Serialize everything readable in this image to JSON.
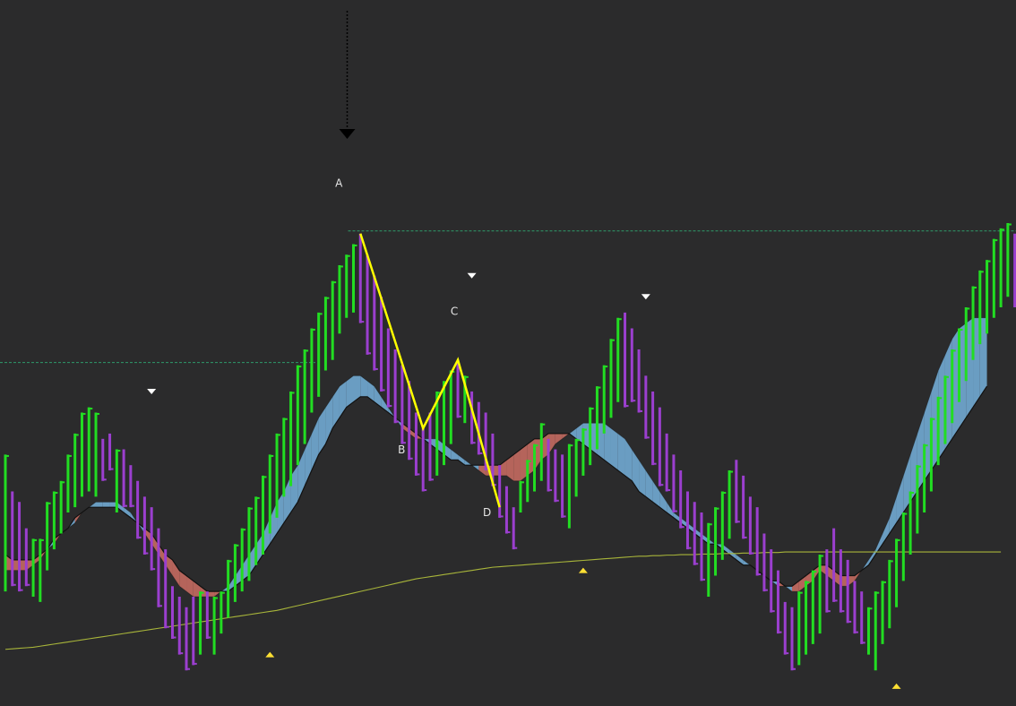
{
  "chart_data": {
    "type": "ohlc-bar",
    "background": "#2b2b2c",
    "colors": {
      "up_bar": "#22dd22",
      "down_bar": "#9b3fcf",
      "cloud_bull": "#6a9dc2",
      "cloud_bear": "#b5645b",
      "slow_ma": "#a8b53a",
      "abcd_pattern": "#ffff00",
      "signal_marker_down": "#ffffff",
      "signal_marker_up": "#ffe033",
      "level_line": "#2e9b6a"
    },
    "price_range": [
      0,
      100
    ],
    "bars": [
      {
        "h": 38,
        "l": 12,
        "d": "u"
      },
      {
        "h": 31,
        "l": 13,
        "d": "d"
      },
      {
        "h": 29,
        "l": 12,
        "d": "d"
      },
      {
        "h": 24,
        "l": 13,
        "d": "d"
      },
      {
        "h": 22,
        "l": 11,
        "d": "u"
      },
      {
        "h": 22,
        "l": 10,
        "d": "u"
      },
      {
        "h": 29,
        "l": 16,
        "d": "u"
      },
      {
        "h": 31,
        "l": 20,
        "d": "u"
      },
      {
        "h": 33,
        "l": 23,
        "d": "u"
      },
      {
        "h": 38,
        "l": 27,
        "d": "u"
      },
      {
        "h": 42,
        "l": 28,
        "d": "u"
      },
      {
        "h": 46,
        "l": 30,
        "d": "u"
      },
      {
        "h": 47,
        "l": 31,
        "d": "u"
      },
      {
        "h": 46,
        "l": 30,
        "d": "u"
      },
      {
        "h": 41,
        "l": 33,
        "d": "d"
      },
      {
        "h": 42,
        "l": 35,
        "d": "d"
      },
      {
        "h": 39,
        "l": 27,
        "d": "u"
      },
      {
        "h": 39,
        "l": 28,
        "d": "d"
      },
      {
        "h": 36,
        "l": 28,
        "d": "d"
      },
      {
        "h": 33,
        "l": 22,
        "d": "d"
      },
      {
        "h": 30,
        "l": 19,
        "d": "d"
      },
      {
        "h": 28,
        "l": 16,
        "d": "d"
      },
      {
        "h": 24,
        "l": 9,
        "d": "d"
      },
      {
        "h": 20,
        "l": 5,
        "d": "d"
      },
      {
        "h": 13,
        "l": 3,
        "d": "d"
      },
      {
        "h": 11,
        "l": 0,
        "d": "d"
      },
      {
        "h": 9,
        "l": -3,
        "d": "d"
      },
      {
        "h": 11,
        "l": -2,
        "d": "d"
      },
      {
        "h": 12,
        "l": 0,
        "d": "u"
      },
      {
        "h": 12,
        "l": 3,
        "d": "d"
      },
      {
        "h": 11,
        "l": 0,
        "d": "u"
      },
      {
        "h": 12,
        "l": 4,
        "d": "u"
      },
      {
        "h": 18,
        "l": 7,
        "d": "u"
      },
      {
        "h": 21,
        "l": 10,
        "d": "u"
      },
      {
        "h": 24,
        "l": 12,
        "d": "u"
      },
      {
        "h": 28,
        "l": 14,
        "d": "u"
      },
      {
        "h": 30,
        "l": 17,
        "d": "u"
      },
      {
        "h": 34,
        "l": 19,
        "d": "u"
      },
      {
        "h": 38,
        "l": 23,
        "d": "u"
      },
      {
        "h": 42,
        "l": 26,
        "d": "u"
      },
      {
        "h": 45,
        "l": 30,
        "d": "u"
      },
      {
        "h": 50,
        "l": 32,
        "d": "u"
      },
      {
        "h": 55,
        "l": 36,
        "d": "u"
      },
      {
        "h": 58,
        "l": 40,
        "d": "u"
      },
      {
        "h": 62,
        "l": 46,
        "d": "u"
      },
      {
        "h": 65,
        "l": 49,
        "d": "u"
      },
      {
        "h": 68,
        "l": 54,
        "d": "u"
      },
      {
        "h": 71,
        "l": 56,
        "d": "u"
      },
      {
        "h": 74,
        "l": 61,
        "d": "u"
      },
      {
        "h": 76,
        "l": 64,
        "d": "u"
      },
      {
        "h": 78,
        "l": 65,
        "d": "u"
      },
      {
        "h": 80,
        "l": 63,
        "d": "d"
      },
      {
        "h": 76,
        "l": 57,
        "d": "d"
      },
      {
        "h": 72,
        "l": 54,
        "d": "d"
      },
      {
        "h": 68,
        "l": 50,
        "d": "d"
      },
      {
        "h": 62,
        "l": 47,
        "d": "d"
      },
      {
        "h": 58,
        "l": 44,
        "d": "d"
      },
      {
        "h": 55,
        "l": 40,
        "d": "d"
      },
      {
        "h": 52,
        "l": 37,
        "d": "d"
      },
      {
        "h": 46,
        "l": 34,
        "d": "d"
      },
      {
        "h": 43,
        "l": 31,
        "d": "d"
      },
      {
        "h": 46,
        "l": 33,
        "d": "d"
      },
      {
        "h": 50,
        "l": 34,
        "d": "u"
      },
      {
        "h": 52,
        "l": 36,
        "d": "u"
      },
      {
        "h": 54,
        "l": 40,
        "d": "u"
      },
      {
        "h": 56,
        "l": 45,
        "d": "d"
      },
      {
        "h": 53,
        "l": 44,
        "d": "u"
      },
      {
        "h": 50,
        "l": 40,
        "d": "d"
      },
      {
        "h": 48,
        "l": 38,
        "d": "d"
      },
      {
        "h": 46,
        "l": 35,
        "d": "d"
      },
      {
        "h": 42,
        "l": 32,
        "d": "d"
      },
      {
        "h": 36,
        "l": 26,
        "d": "d"
      },
      {
        "h": 32,
        "l": 23,
        "d": "d"
      },
      {
        "h": 28,
        "l": 20,
        "d": "d"
      },
      {
        "h": 33,
        "l": 27,
        "d": "u"
      },
      {
        "h": 37,
        "l": 29,
        "d": "u"
      },
      {
        "h": 40,
        "l": 31,
        "d": "u"
      },
      {
        "h": 44,
        "l": 33,
        "d": "u"
      },
      {
        "h": 41,
        "l": 31,
        "d": "d"
      },
      {
        "h": 39,
        "l": 29,
        "d": "d"
      },
      {
        "h": 38,
        "l": 26,
        "d": "d"
      },
      {
        "h": 40,
        "l": 24,
        "d": "u"
      },
      {
        "h": 41,
        "l": 30,
        "d": "u"
      },
      {
        "h": 43,
        "l": 34,
        "d": "u"
      },
      {
        "h": 47,
        "l": 36,
        "d": "u"
      },
      {
        "h": 51,
        "l": 39,
        "d": "u"
      },
      {
        "h": 55,
        "l": 42,
        "d": "u"
      },
      {
        "h": 60,
        "l": 45,
        "d": "u"
      },
      {
        "h": 64,
        "l": 48,
        "d": "u"
      },
      {
        "h": 65,
        "l": 47,
        "d": "d"
      },
      {
        "h": 62,
        "l": 48,
        "d": "d"
      },
      {
        "h": 58,
        "l": 46,
        "d": "d"
      },
      {
        "h": 53,
        "l": 41,
        "d": "d"
      },
      {
        "h": 50,
        "l": 36,
        "d": "d"
      },
      {
        "h": 47,
        "l": 32,
        "d": "d"
      },
      {
        "h": 42,
        "l": 31,
        "d": "d"
      },
      {
        "h": 38,
        "l": 27,
        "d": "d"
      },
      {
        "h": 35,
        "l": 24,
        "d": "d"
      },
      {
        "h": 31,
        "l": 20,
        "d": "d"
      },
      {
        "h": 29,
        "l": 17,
        "d": "d"
      },
      {
        "h": 27,
        "l": 14,
        "d": "d"
      },
      {
        "h": 25,
        "l": 11,
        "d": "u"
      },
      {
        "h": 28,
        "l": 15,
        "d": "u"
      },
      {
        "h": 31,
        "l": 18,
        "d": "u"
      },
      {
        "h": 35,
        "l": 22,
        "d": "u"
      },
      {
        "h": 37,
        "l": 25,
        "d": "d"
      },
      {
        "h": 34,
        "l": 22,
        "d": "d"
      },
      {
        "h": 30,
        "l": 19,
        "d": "d"
      },
      {
        "h": 28,
        "l": 15,
        "d": "d"
      },
      {
        "h": 23,
        "l": 12,
        "d": "d"
      },
      {
        "h": 20,
        "l": 8,
        "d": "d"
      },
      {
        "h": 16,
        "l": 4,
        "d": "d"
      },
      {
        "h": 10,
        "l": 0,
        "d": "d"
      },
      {
        "h": 9,
        "l": -3,
        "d": "d"
      },
      {
        "h": 12,
        "l": -2,
        "d": "u"
      },
      {
        "h": 14,
        "l": 0,
        "d": "u"
      },
      {
        "h": 16,
        "l": 2,
        "d": "u"
      },
      {
        "h": 19,
        "l": 4,
        "d": "u"
      },
      {
        "h": 20,
        "l": 8,
        "d": "d"
      },
      {
        "h": 24,
        "l": 10,
        "d": "d"
      },
      {
        "h": 20,
        "l": 8,
        "d": "d"
      },
      {
        "h": 18,
        "l": 6,
        "d": "d"
      },
      {
        "h": 14,
        "l": 4,
        "d": "d"
      },
      {
        "h": 12,
        "l": 2,
        "d": "d"
      },
      {
        "h": 9,
        "l": 0,
        "d": "u"
      },
      {
        "h": 12,
        "l": -3,
        "d": "u"
      },
      {
        "h": 14,
        "l": 2,
        "d": "u"
      },
      {
        "h": 18,
        "l": 5,
        "d": "u"
      },
      {
        "h": 22,
        "l": 9,
        "d": "u"
      },
      {
        "h": 27,
        "l": 14,
        "d": "u"
      },
      {
        "h": 31,
        "l": 19,
        "d": "u"
      },
      {
        "h": 36,
        "l": 23,
        "d": "u"
      },
      {
        "h": 40,
        "l": 27,
        "d": "u"
      },
      {
        "h": 45,
        "l": 31,
        "d": "u"
      },
      {
        "h": 49,
        "l": 36,
        "d": "u"
      },
      {
        "h": 53,
        "l": 40,
        "d": "u"
      },
      {
        "h": 58,
        "l": 44,
        "d": "u"
      },
      {
        "h": 62,
        "l": 48,
        "d": "u"
      },
      {
        "h": 66,
        "l": 52,
        "d": "u"
      },
      {
        "h": 70,
        "l": 56,
        "d": "u"
      },
      {
        "h": 73,
        "l": 59,
        "d": "u"
      },
      {
        "h": 75,
        "l": 61,
        "d": "u"
      },
      {
        "h": 79,
        "l": 64,
        "d": "u"
      },
      {
        "h": 81,
        "l": 66,
        "d": "u"
      },
      {
        "h": 82,
        "l": 68,
        "d": "u"
      },
      {
        "h": 80,
        "l": 66,
        "d": "d"
      },
      {
        "h": 84,
        "l": 70,
        "d": "u"
      },
      {
        "h": 88,
        "l": 72,
        "d": "u"
      },
      {
        "h": 90,
        "l": 74,
        "d": "u"
      },
      {
        "h": 88,
        "l": 72,
        "d": "d"
      }
    ],
    "ma_fast": [
      16,
      16,
      16,
      16,
      17,
      18,
      20,
      21,
      23,
      24,
      25,
      27,
      28,
      29,
      29,
      29,
      29,
      28,
      27,
      25,
      23,
      21,
      19,
      17,
      15,
      13,
      12,
      11,
      11,
      11,
      11,
      12,
      13,
      15,
      17,
      19,
      21,
      23,
      26,
      29,
      31,
      34,
      36,
      39,
      42,
      45,
      47,
      49,
      51,
      52,
      53,
      53,
      52,
      51,
      49,
      47,
      45,
      43,
      42,
      41,
      41,
      41,
      41,
      40,
      39,
      38,
      37,
      36,
      35,
      34,
      34,
      34,
      34,
      33,
      33,
      34,
      35,
      37,
      38,
      40,
      41,
      42,
      43,
      44,
      44,
      44,
      44,
      43,
      42,
      41,
      39,
      37,
      35,
      33,
      31,
      29,
      27,
      26,
      25,
      24,
      23,
      22,
      21,
      21,
      20,
      19,
      18,
      17,
      16,
      15,
      14,
      13,
      13,
      12,
      12,
      13,
      14,
      16,
      15,
      14,
      13,
      13,
      14,
      16,
      18,
      20,
      23,
      26,
      30,
      34,
      38,
      42,
      46,
      50,
      54,
      57,
      60,
      62,
      63,
      64,
      64,
      64
    ],
    "ma_slow": [
      19,
      18,
      18,
      18,
      18,
      19,
      20,
      22,
      23,
      24,
      26,
      27,
      28,
      28,
      28,
      28,
      28,
      27,
      26,
      25,
      24,
      23,
      21,
      19,
      18,
      16,
      15,
      14,
      13,
      12,
      12,
      12,
      12,
      13,
      14,
      15,
      17,
      19,
      21,
      23,
      25,
      27,
      29,
      32,
      35,
      38,
      40,
      43,
      45,
      47,
      48,
      49,
      49,
      48,
      47,
      46,
      45,
      44,
      43,
      42,
      41,
      40,
      39,
      38,
      37,
      37,
      36,
      36,
      36,
      36,
      36,
      36,
      37,
      38,
      39,
      40,
      41,
      41,
      42,
      42,
      42,
      42,
      41,
      40,
      39,
      38,
      37,
      36,
      35,
      34,
      33,
      31,
      30,
      29,
      28,
      27,
      26,
      25,
      24,
      23,
      22,
      21,
      21,
      20,
      19,
      18,
      17,
      17,
      16,
      15,
      14,
      14,
      13,
      13,
      14,
      15,
      16,
      17,
      17,
      16,
      15,
      15,
      15,
      16,
      17,
      19,
      21,
      23,
      25,
      27,
      29,
      31,
      33,
      35,
      37,
      39,
      41,
      43,
      45,
      47,
      49,
      51
    ],
    "ma_long": [
      1,
      1.1,
      1.2,
      1.3,
      1.4,
      1.6,
      1.8,
      2,
      2.2,
      2.4,
      2.6,
      2.8,
      3,
      3.2,
      3.4,
      3.6,
      3.8,
      4,
      4.2,
      4.4,
      4.6,
      4.8,
      5,
      5.2,
      5.4,
      5.6,
      5.8,
      6,
      6.2,
      6.4,
      6.6,
      6.8,
      7,
      7.2,
      7.4,
      7.6,
      7.8,
      8,
      8.2,
      8.4,
      8.7,
      9,
      9.3,
      9.6,
      9.9,
      10.2,
      10.5,
      10.8,
      11.1,
      11.4,
      11.7,
      12,
      12.3,
      12.6,
      12.9,
      13.2,
      13.5,
      13.8,
      14.1,
      14.4,
      14.6,
      14.8,
      15,
      15.2,
      15.4,
      15.6,
      15.8,
      16,
      16.2,
      16.4,
      16.6,
      16.7,
      16.8,
      16.9,
      17,
      17.1,
      17.2,
      17.3,
      17.4,
      17.5,
      17.6,
      17.7,
      17.8,
      17.9,
      18,
      18.1,
      18.2,
      18.3,
      18.4,
      18.5,
      18.6,
      18.7,
      18.7,
      18.8,
      18.8,
      18.9,
      18.9,
      19,
      19,
      19,
      19.1,
      19.1,
      19.1,
      19.2,
      19.2,
      19.2,
      19.3,
      19.3,
      19.3,
      19.4,
      19.4,
      19.4,
      19.5,
      19.5,
      19.5,
      19.5,
      19.5,
      19.5,
      19.5,
      19.5,
      19.5,
      19.5,
      19.5,
      19.5,
      19.5,
      19.5,
      19.5,
      19.5,
      19.5,
      19.5,
      19.5,
      19.5,
      19.5,
      19.5,
      19.5,
      19.5,
      19.5,
      19.5,
      19.5,
      19.5,
      19.5,
      19.5,
      19.5,
      19.5
    ],
    "abcd": [
      {
        "label": "A",
        "bar": 51,
        "price": 80
      },
      {
        "label": "B",
        "bar": 60,
        "price": 43
      },
      {
        "label": "C",
        "bar": 65,
        "price": 56
      },
      {
        "label": "D",
        "bar": 71,
        "price": 28
      }
    ],
    "level_lines": [
      {
        "price": 55.5,
        "from_bar": 0,
        "to_bar": 44
      },
      {
        "price": 80.5,
        "from_bar": 50,
        "to_bar": 145
      }
    ],
    "signals": [
      {
        "type": "down",
        "bar": 21,
        "price": 50
      },
      {
        "type": "down",
        "bar": 67,
        "price": 72
      },
      {
        "type": "down",
        "bar": 92,
        "price": 68
      },
      {
        "type": "up",
        "bar": 38,
        "price": 0
      },
      {
        "type": "up",
        "bar": 83,
        "price": 16
      },
      {
        "type": "up",
        "bar": 128,
        "price": -6
      }
    ],
    "arrow_bar": 50
  }
}
